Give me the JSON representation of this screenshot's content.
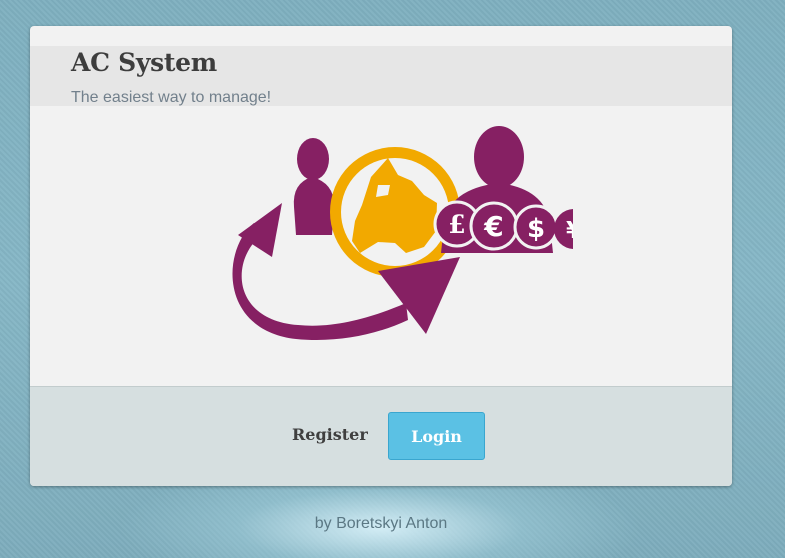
{
  "app": {
    "title": "AC System",
    "subtitle": "The easiest way to manage!"
  },
  "logo": {
    "icon": "currency-exchange-logo",
    "currency_symbols": [
      "£",
      "€",
      "$",
      "¥"
    ]
  },
  "actions": {
    "register_label": "Register",
    "login_label": "Login"
  },
  "footer": {
    "byline": "by Boretskyi Anton"
  },
  "colors": {
    "brand_purple": "#862063",
    "globe_orange": "#f2a900",
    "login_blue": "#5bc1e4"
  }
}
